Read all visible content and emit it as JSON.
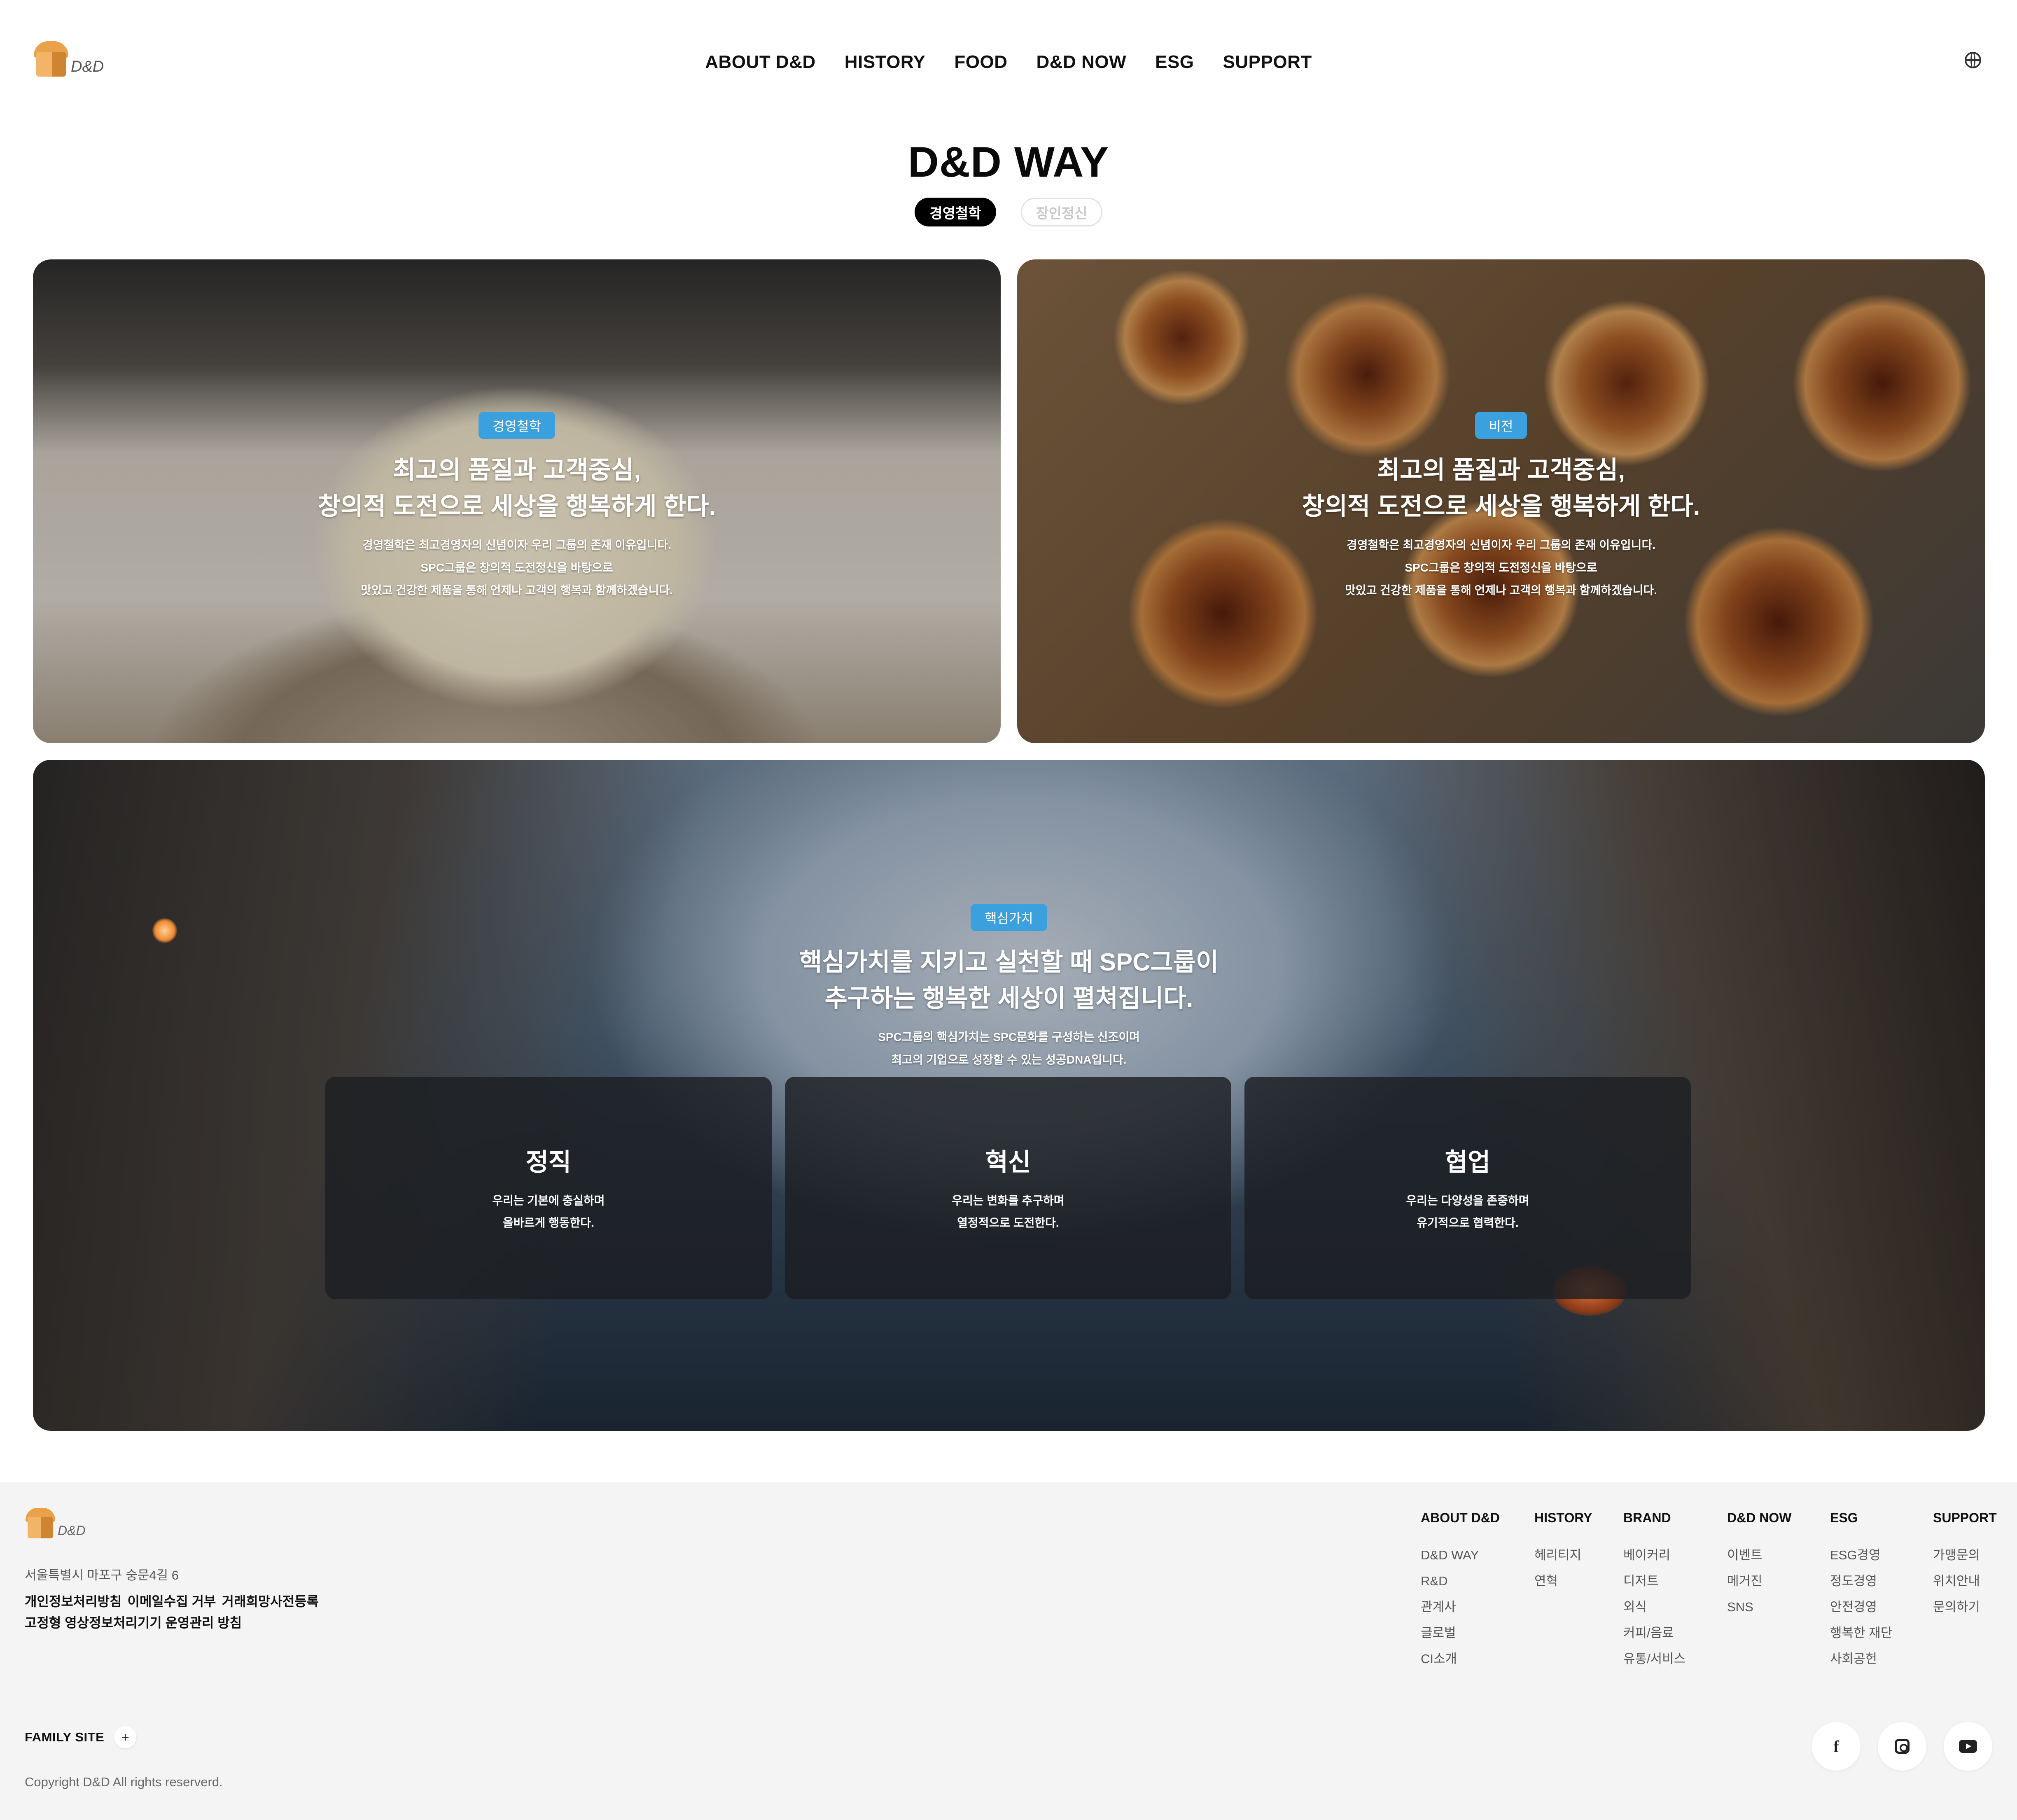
{
  "header": {
    "logo_text": "D&D",
    "nav": [
      "ABOUT D&D",
      "HISTORY",
      "FOOD",
      "D&D NOW",
      "ESG",
      "SUPPORT"
    ]
  },
  "page": {
    "title": "D&D WAY",
    "tabs": [
      {
        "label": "경영철학",
        "active": true
      },
      {
        "label": "장인정신",
        "active": false
      }
    ]
  },
  "cards": {
    "philosophy": {
      "badge": "경영철학",
      "headline_1": "최고의 품질과 고객중심,",
      "headline_2": "창의적 도전으로 세상을 행복하게 한다.",
      "desc_1": "경영철학은 최고경영자의 신념이자 우리 그룹의 존재 이유입니다.",
      "desc_2": "SPC그룹은 창의적 도전정신을 바탕으로",
      "desc_3": "맛있고 건강한 제품을 통해 언제나 고객의 행복과 함께하겠습니다."
    },
    "vision": {
      "badge": "비전",
      "headline_1": "최고의 품질과 고객중심,",
      "headline_2": "창의적 도전으로 세상을 행복하게 한다.",
      "desc_1": "경영철학은 최고경영자의 신념이자 우리 그룹의 존재 이유입니다.",
      "desc_2": "SPC그룹은 창의적 도전정신을 바탕으로",
      "desc_3": "맛있고 건강한 제품을 통해 언제나 고객의 행복과 함께하겠습니다."
    },
    "values": {
      "badge": "핵심가치",
      "headline_1": "핵심가치를 지키고 실천할 때 SPC그룹이",
      "headline_2": "추구하는 행복한 세상이 펼쳐집니다.",
      "desc_1": "SPC그룹의 핵심가치는 SPC문화를 구성하는 신조이며",
      "desc_2": "최고의 기업으로 성장할 수 있는 성공DNA입니다.",
      "items": [
        {
          "title": "정직",
          "line_1": "우리는 기본에 충실하며",
          "line_2": "올바르게 행동한다."
        },
        {
          "title": "혁신",
          "line_1": "우리는 변화를 추구하며",
          "line_2": "열정적으로 도전한다."
        },
        {
          "title": "협업",
          "line_1": "우리는 다양성을 존중하며",
          "line_2": "유기적으로 협력한다."
        }
      ]
    }
  },
  "footer": {
    "logo_text": "D&D",
    "address": "서울특별시 마포구 숭문4길 6",
    "policy_links": [
      "개인정보처리방침",
      "이메일수집 거부",
      "거래희망사전등록"
    ],
    "policy_links_2": [
      "고정형 영상정보처리기기 운영관리 방침"
    ],
    "columns": [
      {
        "title": "ABOUT D&D",
        "items": [
          "D&D WAY",
          "R&D",
          "관계사",
          "글로벌",
          "CI소개"
        ]
      },
      {
        "title": "HISTORY",
        "items": [
          "헤리티지",
          "연혁"
        ]
      },
      {
        "title": "BRAND",
        "items": [
          "베이커리",
          "디저트",
          "외식",
          "커피/음료",
          "유통/서비스"
        ]
      },
      {
        "title": "D&D NOW",
        "items": [
          "이벤트",
          "메거진",
          "SNS"
        ]
      },
      {
        "title": "ESG",
        "items": [
          "ESG경영",
          "정도경영",
          "안전경영",
          "행복한 재단",
          "사회공헌"
        ]
      },
      {
        "title": "SUPPORT",
        "items": [
          "가맹문의",
          "위치안내",
          "문의하기"
        ]
      }
    ],
    "family_site": "FAMILY SITE",
    "family_plus": "+",
    "copyright": "Copyright D&D All rights reserverd.",
    "sns": [
      "facebook-icon",
      "instagram-icon",
      "youtube-icon"
    ]
  }
}
